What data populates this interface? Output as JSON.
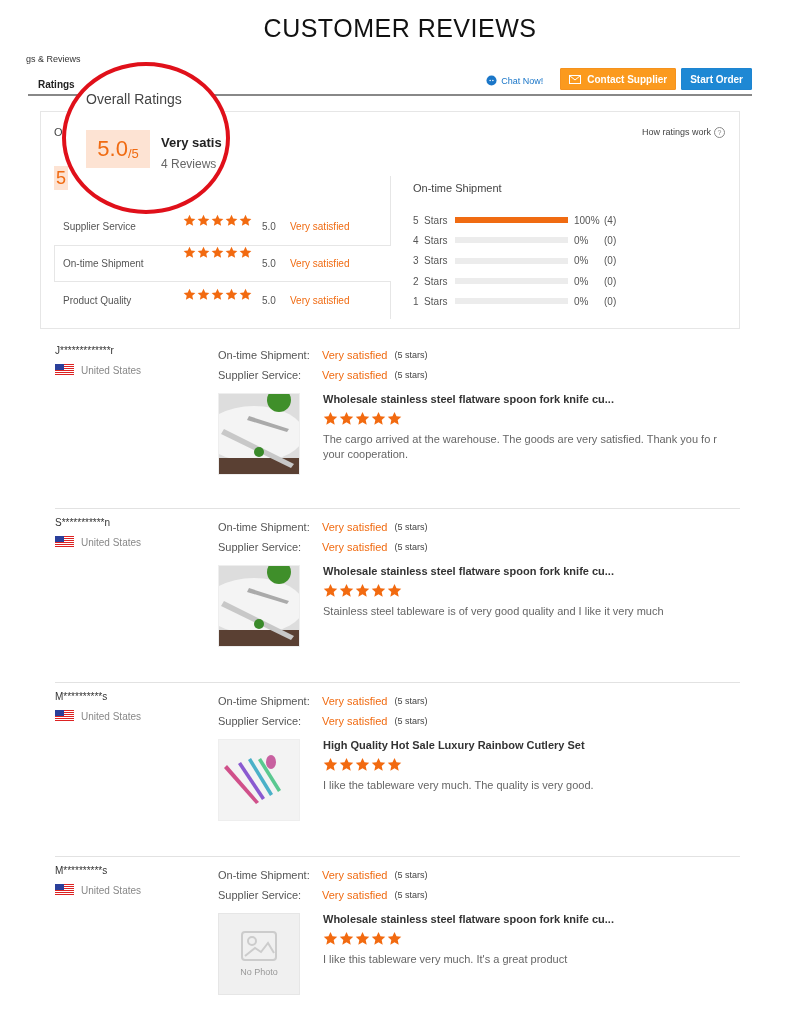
{
  "page_title": "CUSTOMER REVIEWS",
  "header": {
    "breadcrumb": "gs & Reviews",
    "tabs": [
      {
        "label": "Ratings",
        "selected": true
      }
    ],
    "chat": "Chat Now!",
    "buttons": [
      {
        "kind": "contact",
        "label": "Contact Supplier"
      },
      {
        "kind": "order",
        "label": "Start Order"
      }
    ]
  },
  "ratings_card": {
    "title_visible": "O",
    "score_visible": "5",
    "help": "How ratings work",
    "help_icon": "?",
    "rows": [
      {
        "label": "Supplier Service",
        "stars": 5,
        "score": "5.0",
        "verdict": "Very satisfied",
        "selected": false
      },
      {
        "label": "On-time Shipment",
        "stars": 5,
        "score": "5.0",
        "verdict": "Very satisfied",
        "selected": true
      },
      {
        "label": "Product Quality",
        "stars": 5,
        "score": "5.0",
        "verdict": "Very satisfied",
        "selected": false
      }
    ],
    "histogram": {
      "title": "On-time Shipment",
      "rows": [
        {
          "label": "5  Stars",
          "level": 1,
          "percent": "100%",
          "count": "(4)"
        },
        {
          "label": "4  Stars",
          "level": 0,
          "percent": "0%",
          "count": "(0)"
        },
        {
          "label": "3  Stars",
          "level": 0,
          "percent": "0%",
          "count": "(0)"
        },
        {
          "label": "2  Stars",
          "level": 0,
          "percent": "0%",
          "count": "(0)"
        },
        {
          "label": "1  Stars",
          "level": 0,
          "percent": "0%",
          "count": "(0)"
        }
      ]
    }
  },
  "magnifier": {
    "title": "Overall Ratings",
    "score": "5.0",
    "out_of": "/5",
    "verdict": "Very satis",
    "reviews": "4 Reviews"
  },
  "reviews": [
    {
      "name": "J*************r",
      "country": "United States",
      "ratings": [
        {
          "label": "On-time Shipment:",
          "verdict": "Very satisfied",
          "stars_text": "(5 stars)"
        },
        {
          "label": "Supplier Service:",
          "verdict": "Very satisfied",
          "stars_text": "(5 stars)"
        }
      ],
      "image": {
        "kind": "picture"
      },
      "product": "Wholesale stainless steel flatware spoon fork knife cu...",
      "stars": 5,
      "comment": "The cargo arrived at the warehouse. The goods are very satisfied. Thank you fo r your cooperation."
    },
    {
      "name": "S***********n",
      "country": "United States",
      "ratings": [
        {
          "label": "On-time Shipment:",
          "verdict": "Very satisfied",
          "stars_text": "(5 stars)"
        },
        {
          "label": "Supplier Service:",
          "verdict": "Very satisfied",
          "stars_text": "(5 stars)"
        }
      ],
      "image": {
        "kind": "picture"
      },
      "product": "Wholesale stainless steel flatware spoon fork knife cu...",
      "stars": 5,
      "comment": "Stainless steel tableware is of very good quality and I like it very much"
    },
    {
      "name": "M**********s",
      "country": "United States",
      "ratings": [
        {
          "label": "On-time Shipment:",
          "verdict": "Very satisfied",
          "stars_text": "(5 stars)"
        },
        {
          "label": "Supplier Service:",
          "verdict": "Very satisfied",
          "stars_text": "(5 stars)"
        }
      ],
      "image": {
        "kind": "picture"
      },
      "product": "High Quality Hot Sale Luxury Rainbow Cutlery Set",
      "stars": 5,
      "comment": "I like the tableware very much. The quality is very good."
    },
    {
      "name": "M**********s",
      "country": "United States",
      "ratings": [
        {
          "label": "On-time Shipment:",
          "verdict": "Very satisfied",
          "stars_text": "(5 stars)"
        },
        {
          "label": "Supplier Service:",
          "verdict": "Very satisfied",
          "stars_text": "(5 stars)"
        }
      ],
      "image": {
        "kind": "no_photo",
        "label": "No Photo"
      },
      "product": "Wholesale stainless steel flatware spoon fork knife cu...",
      "stars": 5,
      "comment": "I like this tableware very much. It's a great product"
    }
  ]
}
